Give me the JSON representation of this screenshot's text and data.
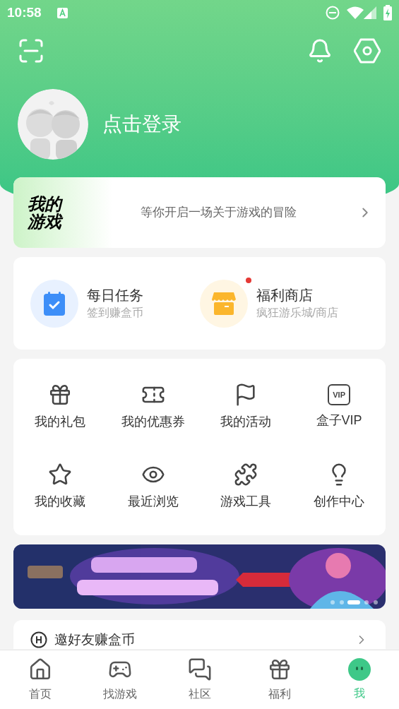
{
  "status_bar": {
    "time": "10:58"
  },
  "profile": {
    "login_label": "点击登录"
  },
  "my_games": {
    "logo_text": "我的游戏",
    "tagline": "等你开启一场关于游戏的冒险"
  },
  "quick_cards": [
    {
      "title": "每日任务",
      "subtitle": "签到赚盒币",
      "badge_dot": false
    },
    {
      "title": "福利商店",
      "subtitle": "疯狂游乐城/商店",
      "badge_dot": true
    }
  ],
  "shortcuts": [
    {
      "kind": "glyph",
      "label": "我的礼包"
    },
    {
      "kind": "glyph",
      "label": "我的优惠券"
    },
    {
      "kind": "glyph",
      "label": "我的活动"
    },
    {
      "kind": "text_icon",
      "icon_text": "VIP",
      "label": "盒子VIP"
    },
    {
      "kind": "glyph",
      "label": "我的收藏"
    },
    {
      "kind": "glyph",
      "label": "最近浏览"
    },
    {
      "kind": "glyph",
      "label": "游戏工具"
    },
    {
      "kind": "glyph",
      "label": "创作中心"
    }
  ],
  "invite_row": {
    "label": "邀好友赚盒币"
  },
  "bottom_nav": [
    {
      "label": "首页",
      "selected": false
    },
    {
      "label": "找游戏",
      "selected": false
    },
    {
      "label": "社区",
      "selected": false
    },
    {
      "label": "福利",
      "selected": false
    },
    {
      "label": "我",
      "selected": true
    }
  ]
}
